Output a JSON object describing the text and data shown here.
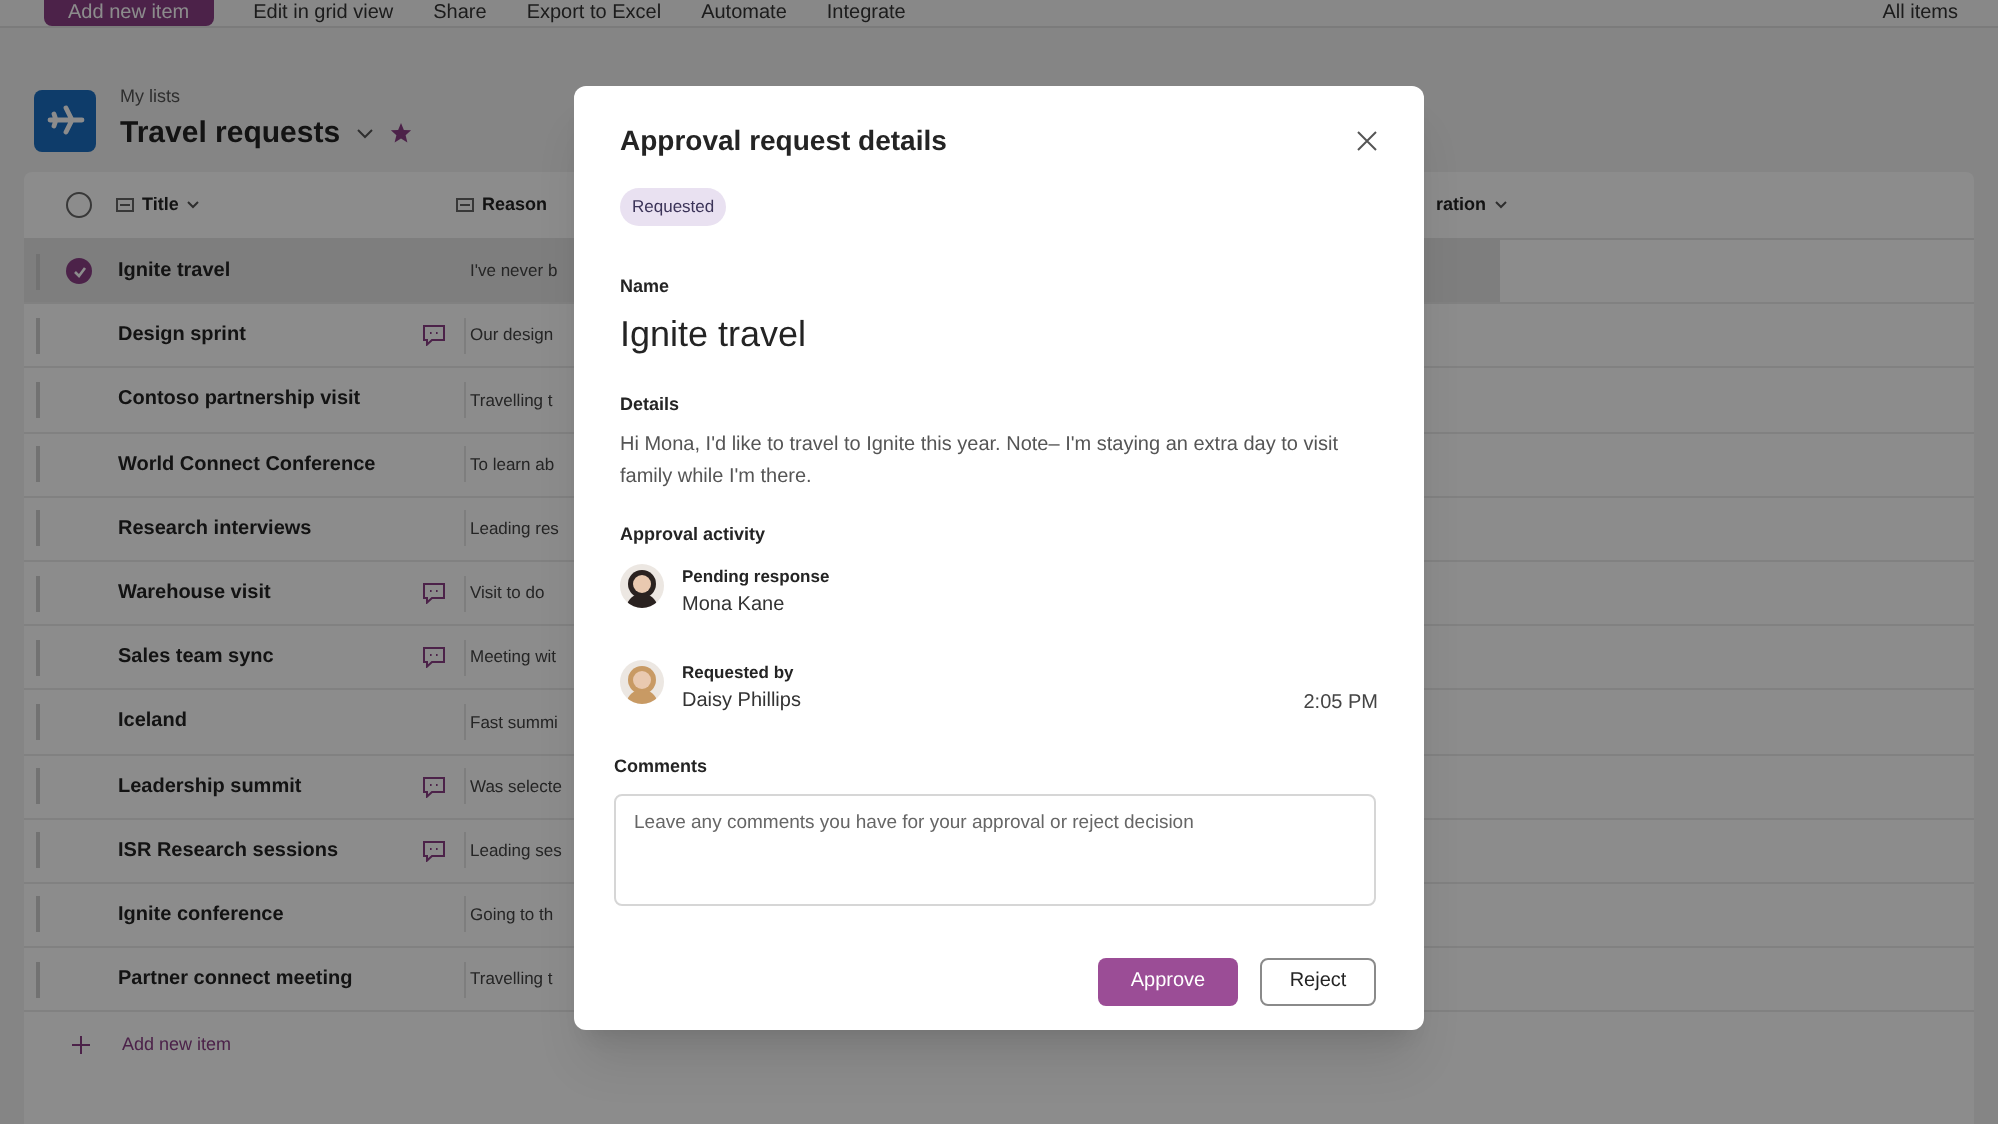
{
  "toolbar": {
    "items": [
      "Add new item",
      "Edit in grid view",
      "Share",
      "Export to Excel",
      "Automate",
      "Integrate"
    ],
    "view": "All items"
  },
  "list_header": {
    "breadcrumb": "My lists",
    "title": "Travel requests",
    "favorite": true
  },
  "table": {
    "all_selected": false,
    "columns": [
      "Title",
      "Reason",
      "ration"
    ],
    "rows": [
      {
        "title": "Ignite travel",
        "has_comments": false,
        "reason": "I've never b",
        "selected": true
      },
      {
        "title": "Design sprint",
        "has_comments": true,
        "reason": "Our design",
        "selected": false
      },
      {
        "title": "Contoso partnership visit",
        "has_comments": false,
        "reason": "Travelling t",
        "selected": false
      },
      {
        "title": "World Connect Conference",
        "has_comments": false,
        "reason": "To learn ab",
        "selected": false
      },
      {
        "title": "Research interviews",
        "has_comments": false,
        "reason": "Leading res",
        "selected": false
      },
      {
        "title": "Warehouse visit",
        "has_comments": true,
        "reason": "Visit to do",
        "selected": false
      },
      {
        "title": "Sales team sync",
        "has_comments": true,
        "reason": "Meeting wit",
        "selected": false
      },
      {
        "title": "Iceland",
        "has_comments": false,
        "reason": "Fast summi",
        "selected": false
      },
      {
        "title": "Leadership summit",
        "has_comments": true,
        "reason": "Was selecte",
        "selected": false
      },
      {
        "title": "ISR Research sessions",
        "has_comments": true,
        "reason": "Leading ses",
        "selected": false
      },
      {
        "title": "Ignite conference",
        "has_comments": false,
        "reason": "Going to th",
        "selected": false
      },
      {
        "title": "Partner connect meeting",
        "has_comments": false,
        "reason": "Travelling t",
        "selected": false
      }
    ],
    "add_item": "Add new item"
  },
  "dialog": {
    "title": "Approval request details",
    "status": "Requested",
    "name_label": "Name",
    "name": "Ignite travel",
    "details_label": "Details",
    "details": "Hi Mona, I'd like to travel to Ignite this year. Note– I'm staying an extra day to visit family while I'm there.",
    "activity_label": "Approval activity",
    "activity": [
      {
        "label": "Pending response",
        "person": "Mona Kane"
      },
      {
        "label": "Requested by",
        "person": "Daisy Phillips",
        "time": "2:05 PM"
      }
    ],
    "comments_label": "Comments",
    "comments": {
      "placeholder": "Leave any comments you have for your approval or reject decision"
    },
    "buttons": [
      "Approve",
      "Reject"
    ]
  }
}
